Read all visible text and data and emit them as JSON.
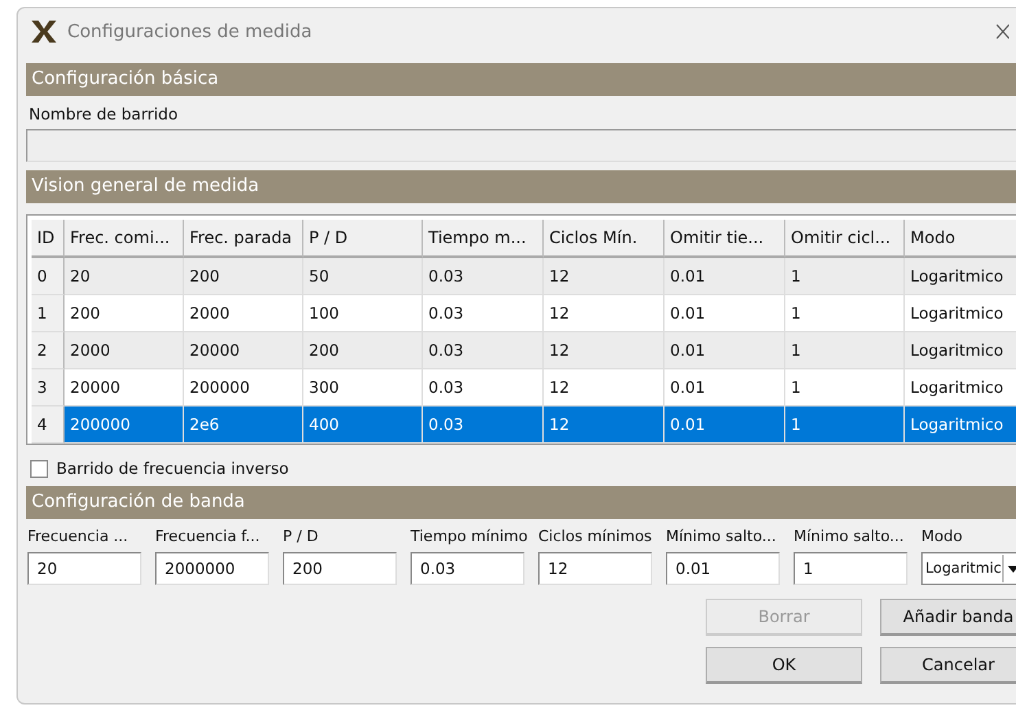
{
  "window": {
    "title": "Configuraciones de medida"
  },
  "basic": {
    "header": "Configuración básica",
    "name_label": "Nombre de barrido"
  },
  "overview": {
    "header": "Vision general de medida",
    "columns": [
      "ID",
      "Frec. comi...",
      "Frec. parada",
      "P / D",
      "Tiempo m...",
      "Ciclos Mín.",
      "Omitir tie...",
      "Omitir cicl...",
      "Modo"
    ],
    "rows": [
      {
        "cells": [
          "0",
          "20",
          "200",
          "50",
          "0.03",
          "12",
          "0.01",
          "1",
          "Logaritmico"
        ],
        "selected": false
      },
      {
        "cells": [
          "1",
          "200",
          "2000",
          "100",
          "0.03",
          "12",
          "0.01",
          "1",
          "Logaritmico"
        ],
        "selected": false
      },
      {
        "cells": [
          "2",
          "2000",
          "20000",
          "200",
          "0.03",
          "12",
          "0.01",
          "1",
          "Logaritmico"
        ],
        "selected": false
      },
      {
        "cells": [
          "3",
          "20000",
          "200000",
          "300",
          "0.03",
          "12",
          "0.01",
          "1",
          "Logaritmico"
        ],
        "selected": false
      },
      {
        "cells": [
          "4",
          "200000",
          "2e6",
          "400",
          "0.03",
          "12",
          "0.01",
          "1",
          "Logaritmico"
        ],
        "selected": true
      }
    ]
  },
  "reverse_sweep": {
    "label": "Barrido de frecuencia inverso",
    "checked": false
  },
  "band": {
    "header": "Configuración de banda",
    "fields": [
      {
        "label": "Frecuencia ...",
        "value": "20",
        "kind": "text"
      },
      {
        "label": "Frecuencia f...",
        "value": "2000000",
        "kind": "text"
      },
      {
        "label": "P / D",
        "value": "200",
        "kind": "text"
      },
      {
        "label": "Tiempo mínimo",
        "value": "0.03",
        "kind": "text"
      },
      {
        "label": "Ciclos mínimos",
        "value": "12",
        "kind": "text"
      },
      {
        "label": "Mínimo salto...",
        "value": "0.01",
        "kind": "text"
      },
      {
        "label": "Mínimo salto...",
        "value": "1",
        "kind": "text"
      },
      {
        "label": "Modo",
        "value": "Logaritmic",
        "kind": "dropdown"
      }
    ]
  },
  "buttons": [
    {
      "label": "Borrar",
      "disabled": true
    },
    {
      "label": "Añadir banda",
      "disabled": false
    },
    {
      "label": "OK",
      "disabled": false
    },
    {
      "label": "Cancelar",
      "disabled": false
    }
  ]
}
